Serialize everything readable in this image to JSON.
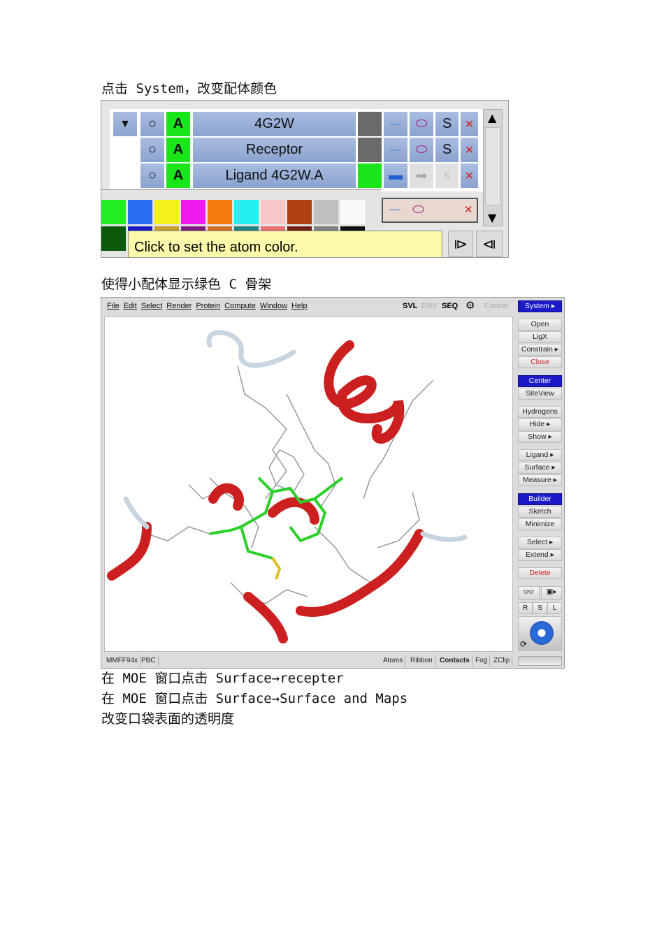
{
  "captions": {
    "c1": "点击 System，改变配体颜色",
    "c2": "使得小配体显示绿色 C 骨架",
    "c3": "在 MOE 窗口点击 Surface→recepter",
    "c4": "在 MOE 窗口点击 Surface→Surface and Maps",
    "c5": "改变口袋表面的透明度"
  },
  "panel": {
    "rows": [
      {
        "name": "4G2W",
        "atom": "A",
        "s": "S"
      },
      {
        "name": "Receptor",
        "atom": "A",
        "s": "S"
      },
      {
        "name": "Ligand 4G2W.A",
        "atom": "A",
        "s": "S"
      }
    ],
    "tooltip": "Click to set the atom color.",
    "palette_top": [
      "#22ee22",
      "#2a6ef0",
      "#f4f01a",
      "#f01af0",
      "#f47a10",
      "#22f0f0",
      "#f8c8c8",
      "#b04010",
      "#c0c0c0",
      "#fafafa"
    ],
    "palette_bottom": [
      "#0a5a0a",
      "#1a1ac0",
      "#c8a030",
      "#801a80",
      "#d07020",
      "#208080",
      "#e87070",
      "#702010",
      "#808080",
      "#101010"
    ]
  },
  "moe": {
    "menu": [
      "File",
      "Edit",
      "Select",
      "Render",
      "Protein",
      "Compute",
      "Window",
      "Help"
    ],
    "toolbar": {
      "svl": "SVL",
      "dbv": "DBV",
      "seq": "SEQ",
      "cancel": "Cancel",
      "system": "System ▸"
    },
    "right_panel": [
      "Open",
      "LigX",
      "Constrain ▸",
      "Close",
      "Center",
      "SiteView",
      "Hydrogens",
      "Hide ▸",
      "Show ▸",
      "Ligand ▸",
      "Surface ▸",
      "Measure ▸",
      "Builder",
      "Sketch",
      "Minimize",
      "Select ▸",
      "Extend ▸",
      "Delete"
    ],
    "rsl": [
      "R",
      "S",
      "L"
    ],
    "status_left": [
      "MMFF94x",
      "PBC"
    ],
    "status_right": [
      "Atoms",
      "Ribbon",
      "Contacts",
      "Fog",
      "ZClip"
    ]
  }
}
